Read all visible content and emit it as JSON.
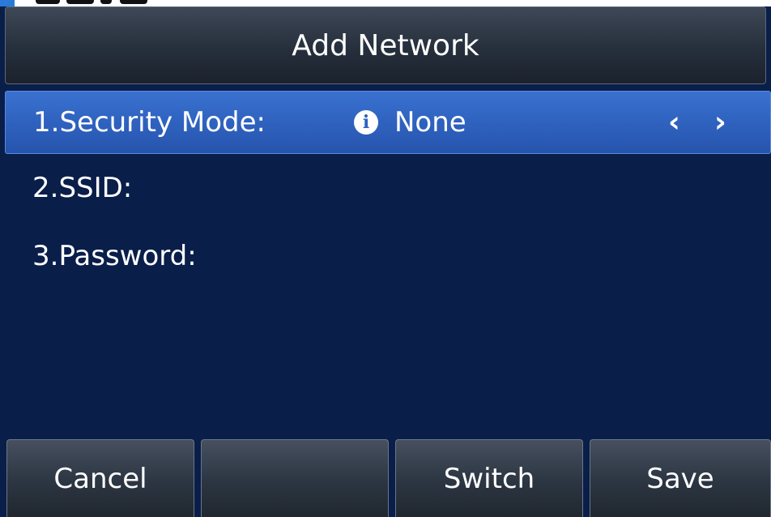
{
  "title": "Add Network",
  "items": [
    {
      "label": "1.Security Mode:",
      "value": "None",
      "selected": true
    },
    {
      "label": "2.SSID:",
      "value": ""
    },
    {
      "label": "3.Password:",
      "value": ""
    }
  ],
  "icons": {
    "info": "i",
    "left_arrow": "‹",
    "right_arrow": "›"
  },
  "softkeys": [
    "Cancel",
    "",
    "Switch",
    "Save"
  ],
  "colors": {
    "background": "#0a1e4a",
    "selected_row": "#2f62bf",
    "title_bar": "#262f3c",
    "text": "#ffffff"
  }
}
